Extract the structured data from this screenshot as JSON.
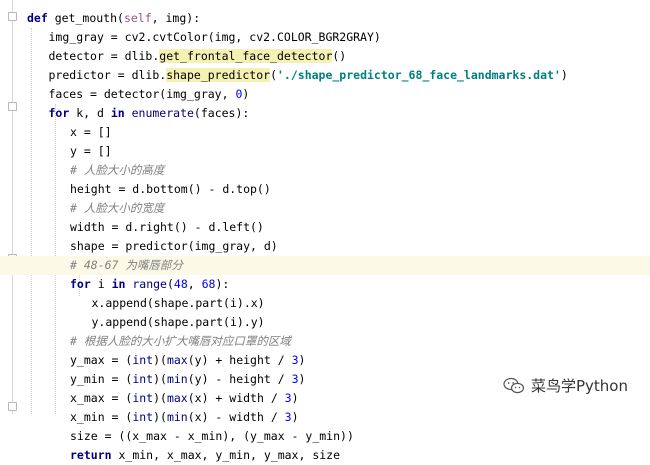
{
  "editor": {
    "lines": [
      {
        "indent": 0,
        "tokens": [
          {
            "t": "def ",
            "c": "kw"
          },
          {
            "t": "get_mouth("
          },
          {
            "t": "self",
            "c": "self"
          },
          {
            "t": ", img):"
          }
        ]
      },
      {
        "indent": 1,
        "tokens": [
          {
            "t": "img_gray = cv2.cvtColor(img, cv2.COLOR_BGR2GRAY)"
          }
        ]
      },
      {
        "indent": 1,
        "tokens": [
          {
            "t": "detector = dlib."
          },
          {
            "t": "get_frontal_face_detector",
            "c": "fn"
          },
          {
            "t": "()"
          }
        ]
      },
      {
        "indent": 1,
        "tokens": [
          {
            "t": "predictor = dlib."
          },
          {
            "t": "shape_predictor",
            "c": "fn"
          },
          {
            "t": "("
          },
          {
            "t": "'./shape_predictor_68_face_landmarks.dat'",
            "c": "str"
          },
          {
            "t": ")"
          }
        ]
      },
      {
        "indent": 1,
        "tokens": [
          {
            "t": "faces = detector(img_gray, "
          },
          {
            "t": "0",
            "c": "num"
          },
          {
            "t": ")"
          }
        ]
      },
      {
        "indent": 1,
        "tokens": [
          {
            "t": "for ",
            "c": "kw"
          },
          {
            "t": "k, d "
          },
          {
            "t": "in ",
            "c": "kw"
          },
          {
            "t": "enumerate",
            "c": "bi"
          },
          {
            "t": "(faces):"
          }
        ]
      },
      {
        "indent": 2,
        "tokens": [
          {
            "t": "x = []"
          }
        ]
      },
      {
        "indent": 2,
        "tokens": [
          {
            "t": "y = []"
          }
        ]
      },
      {
        "indent": 2,
        "tokens": [
          {
            "t": "# 人脸大小的高度",
            "c": "cmt"
          }
        ]
      },
      {
        "indent": 2,
        "tokens": [
          {
            "t": "height = d.bottom() - d.top()"
          }
        ]
      },
      {
        "indent": 2,
        "tokens": [
          {
            "t": "# 人脸大小的宽度",
            "c": "cmt"
          }
        ]
      },
      {
        "indent": 2,
        "tokens": [
          {
            "t": "width = d.right() - d.left()"
          }
        ]
      },
      {
        "indent": 2,
        "tokens": [
          {
            "t": "shape = predictor(img_gray, d)"
          }
        ]
      },
      {
        "indent": 2,
        "hl": true,
        "tokens": [
          {
            "t": "# 48-67 为嘴唇部分",
            "c": "cmt"
          }
        ]
      },
      {
        "indent": 2,
        "tokens": [
          {
            "t": "for ",
            "c": "kw"
          },
          {
            "t": "i "
          },
          {
            "t": "in ",
            "c": "kw"
          },
          {
            "t": "range",
            "c": "bi"
          },
          {
            "t": "("
          },
          {
            "t": "48",
            "c": "num"
          },
          {
            "t": ", "
          },
          {
            "t": "68",
            "c": "num"
          },
          {
            "t": "):"
          }
        ]
      },
      {
        "indent": 3,
        "tokens": [
          {
            "t": "x.append(shape.part(i).x)"
          }
        ]
      },
      {
        "indent": 3,
        "tokens": [
          {
            "t": "y.append(shape.part(i).y)"
          }
        ]
      },
      {
        "indent": 2,
        "tokens": [
          {
            "t": "# 根据人脸的大小扩大嘴唇对应口罩的区域",
            "c": "cmt"
          }
        ]
      },
      {
        "indent": 2,
        "tokens": [
          {
            "t": "y_max = ("
          },
          {
            "t": "int",
            "c": "bi"
          },
          {
            "t": ")("
          },
          {
            "t": "max",
            "c": "bi"
          },
          {
            "t": "(y) + height / "
          },
          {
            "t": "3",
            "c": "num"
          },
          {
            "t": ")"
          }
        ]
      },
      {
        "indent": 2,
        "tokens": [
          {
            "t": "y_min = ("
          },
          {
            "t": "int",
            "c": "bi"
          },
          {
            "t": ")("
          },
          {
            "t": "min",
            "c": "bi"
          },
          {
            "t": "(y) - height / "
          },
          {
            "t": "3",
            "c": "num"
          },
          {
            "t": ")"
          }
        ]
      },
      {
        "indent": 2,
        "tokens": [
          {
            "t": "x_max = ("
          },
          {
            "t": "int",
            "c": "bi"
          },
          {
            "t": ")("
          },
          {
            "t": "max",
            "c": "bi"
          },
          {
            "t": "(x) + width / "
          },
          {
            "t": "3",
            "c": "num"
          },
          {
            "t": ")"
          }
        ]
      },
      {
        "indent": 2,
        "tokens": [
          {
            "t": "x_min = ("
          },
          {
            "t": "int",
            "c": "bi"
          },
          {
            "t": ")("
          },
          {
            "t": "min",
            "c": "bi"
          },
          {
            "t": "(x) - width / "
          },
          {
            "t": "3",
            "c": "num"
          },
          {
            "t": ")"
          }
        ]
      },
      {
        "indent": 2,
        "tokens": [
          {
            "t": "size = ((x_max - x_min), (y_max - y_min))"
          }
        ]
      },
      {
        "indent": 2,
        "tokens": [
          {
            "t": "return ",
            "c": "kw"
          },
          {
            "t": "x_min, x_max, y_min, y_max, size"
          }
        ]
      }
    ]
  },
  "watermark": {
    "text": "菜鸟学Python",
    "icon": "wechat-icon"
  },
  "colors": {
    "keyword": "#000080",
    "self": "#94558d",
    "number": "#0000ff",
    "string": "#008080",
    "comment": "#808080",
    "highlight_line": "#fcfae6",
    "function_highlight": "#f5f1b3"
  }
}
